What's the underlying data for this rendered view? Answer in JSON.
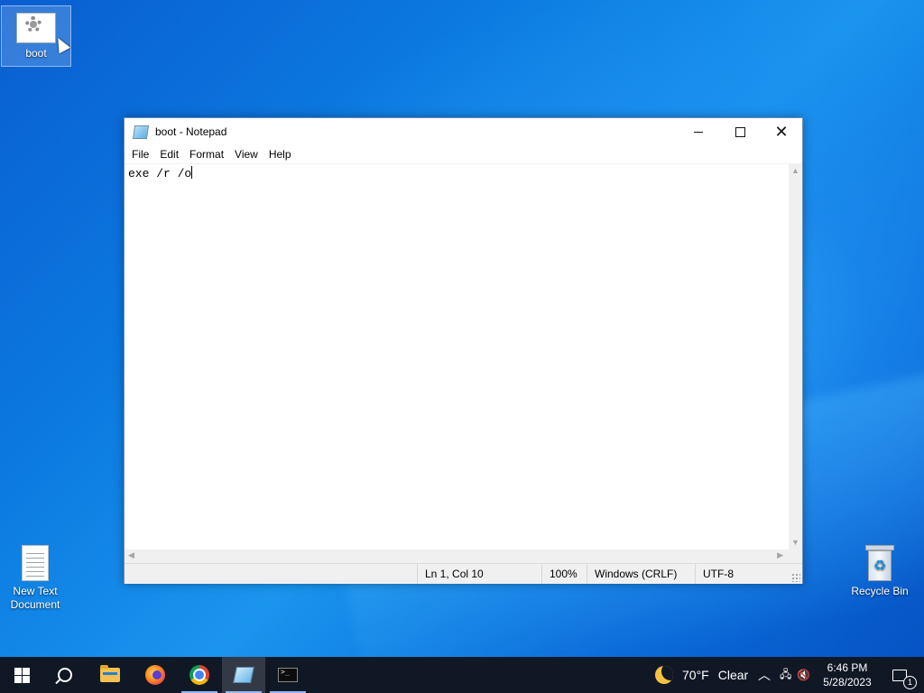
{
  "desktop": {
    "icons": [
      {
        "label": "boot"
      },
      {
        "label": "New Text Document"
      },
      {
        "label": "Recycle Bin"
      }
    ]
  },
  "window": {
    "title": "boot - Notepad",
    "controls": {
      "minimize": "minimize-icon",
      "maximize": "maximize-icon",
      "close": "✕"
    },
    "menu": [
      "File",
      "Edit",
      "Format",
      "View",
      "Help"
    ],
    "editor_text": "exe /r /o",
    "status": {
      "position": "Ln 1, Col 10",
      "zoom": "100%",
      "line_ending": "Windows (CRLF)",
      "encoding": "UTF-8"
    }
  },
  "taskbar": {
    "apps": [
      {
        "name": "start-icon"
      },
      {
        "name": "search-icon"
      },
      {
        "name": "file-explorer-icon"
      },
      {
        "name": "firefox-icon"
      },
      {
        "name": "chrome-icon"
      },
      {
        "name": "notepad-icon"
      },
      {
        "name": "terminal-icon"
      }
    ],
    "weather": {
      "temp": "70°F",
      "condition": "Clear"
    },
    "clock": {
      "time": "6:46 PM",
      "date": "5/28/2023"
    },
    "notifications_count": "1",
    "terminal_glyph": ">_"
  },
  "colors": {
    "taskbar_bg": "#101826",
    "accent": "#1a95ee"
  }
}
